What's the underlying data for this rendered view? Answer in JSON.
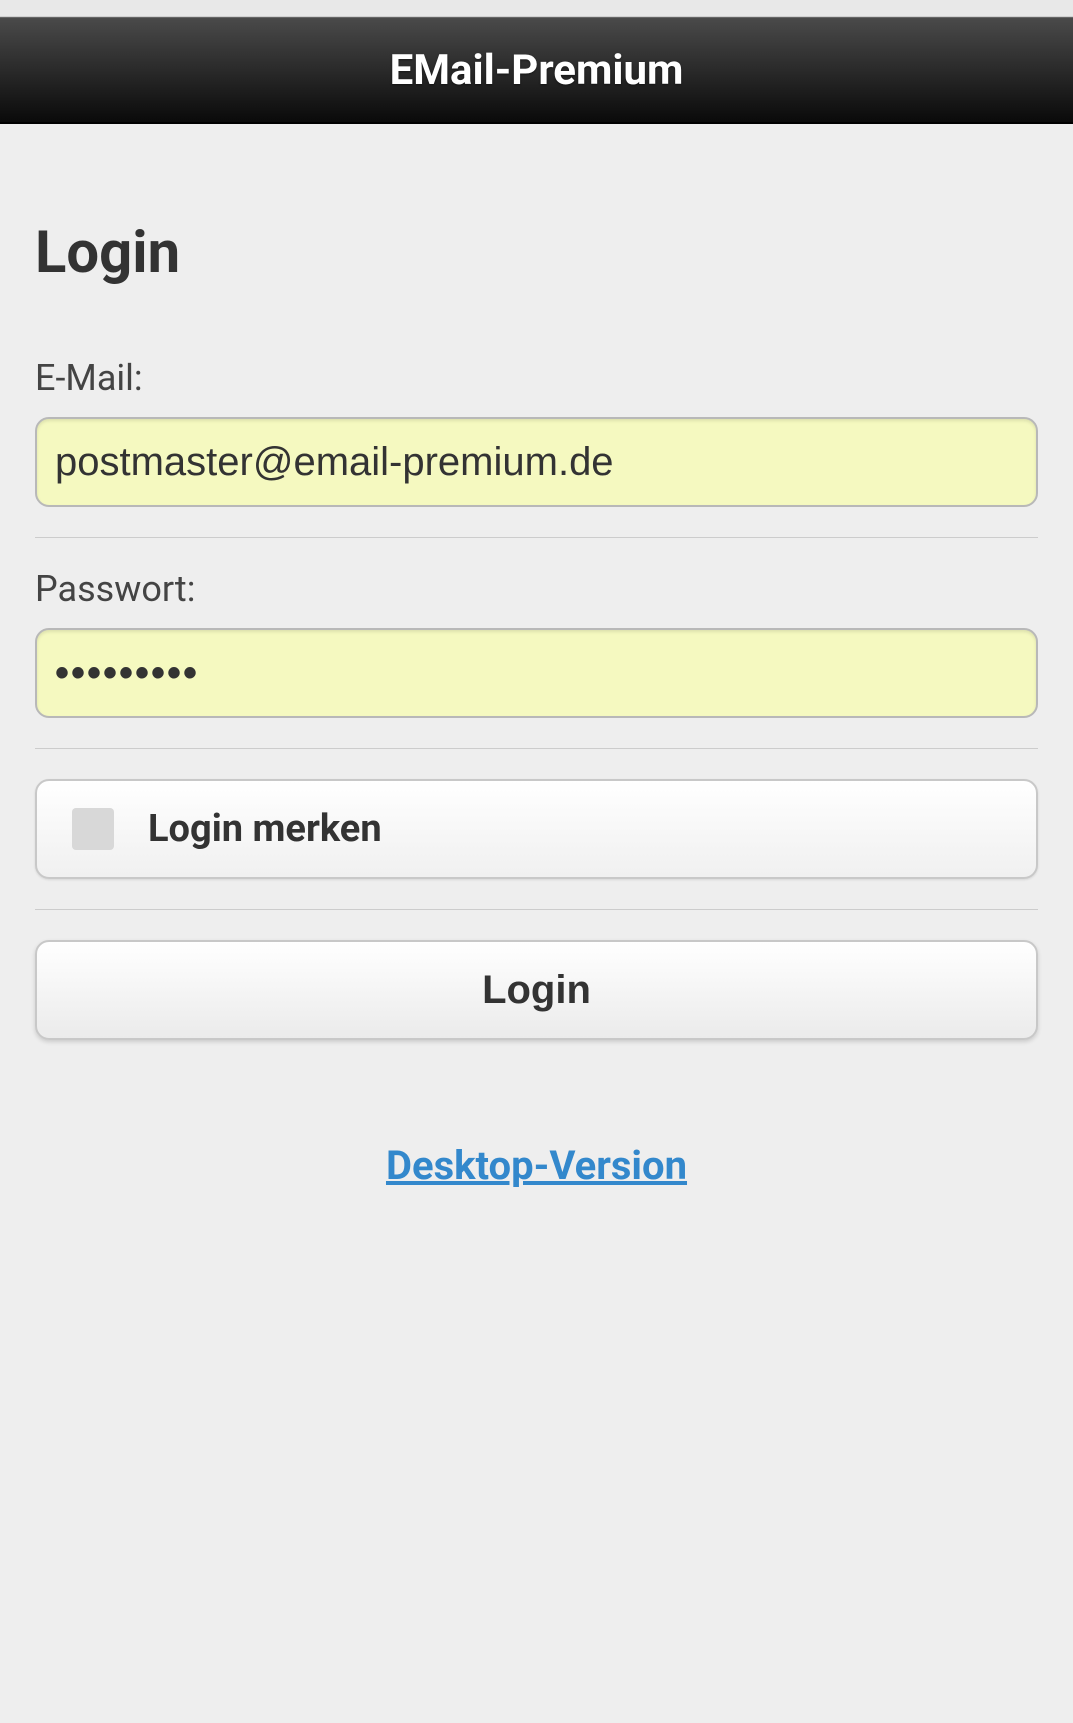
{
  "header": {
    "title": "EMail-Premium"
  },
  "login": {
    "heading": "Login",
    "email_label": "E-Mail:",
    "email_value": "postmaster@email-premium.de",
    "password_label": "Passwort:",
    "password_value": "•••••••••",
    "remember_label": "Login merken",
    "submit_label": "Login",
    "desktop_link": "Desktop-Version"
  }
}
